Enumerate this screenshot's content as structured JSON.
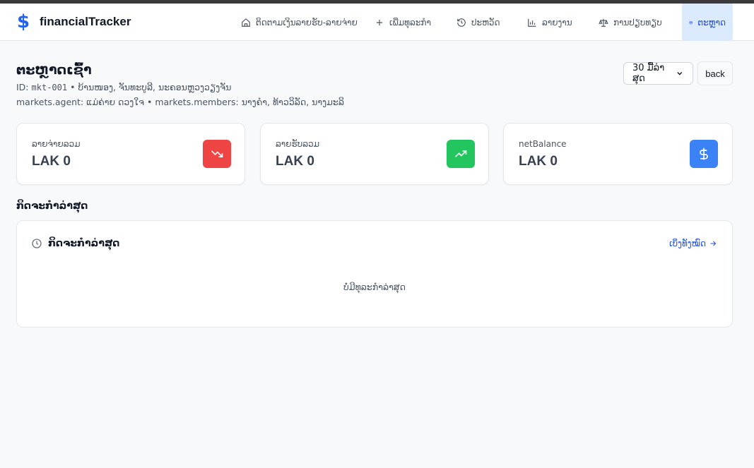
{
  "app": {
    "name": "financialTracker",
    "brand_icon": "$"
  },
  "nav": {
    "items": [
      {
        "label": "ຕິດຕາມເງິນລາຍຮັບ-ລາຍຈ່າຍ",
        "icon": "home-icon"
      },
      {
        "label": "ເພີ່ມທຸລະກຳ",
        "icon": "plus-icon"
      },
      {
        "label": "ປະຫວັດ",
        "icon": "history-icon"
      },
      {
        "label": "ລາຍງານ",
        "icon": "bar-chart-icon"
      },
      {
        "label": "ການປຽບທຽບ",
        "icon": "scale-icon"
      },
      {
        "label": "ຕະຫຼາດ",
        "icon": "store-icon",
        "active": true
      }
    ]
  },
  "market": {
    "title": "ຕະຫຼາດເຊົ້າ",
    "id_label": "ID:",
    "id": "mkt-001",
    "location": "• ບ້ານໜອງ, ຈັນທະບູລີ, ນະຄອນຫຼວງວຽງຈັນ",
    "agent_line": "markets.agent: ແມ່ຄ່າຍ ດວງໃຈ • markets.members: ນາງຄຳ, ທ້າວວິລັດ, ນາງມະລິ"
  },
  "controls": {
    "range_selected": "30 ມື້ລ່າສຸດ",
    "back_label": "back"
  },
  "stats": [
    {
      "label": "ລາຍຈ່າຍລວມ",
      "value": "LAK 0",
      "icon": "trending-down-icon",
      "color": "#ef4444"
    },
    {
      "label": "ລາຍຮັບລວມ",
      "value": "LAK 0",
      "icon": "trending-up-icon",
      "color": "#22c55e"
    },
    {
      "label": "netBalance",
      "value": "LAK 0",
      "icon": "dollar-icon",
      "color": "#3b82f6"
    }
  ],
  "activity": {
    "section_title": "ກິດຈະກຳລ່າສຸດ",
    "card_title": "ກິດຈະກຳລ່າສຸດ",
    "view_all": "ເບິ່ງທັງໝົດ",
    "empty": "ບໍ່ມີທຸລະກຳລ່າສຸດ"
  }
}
